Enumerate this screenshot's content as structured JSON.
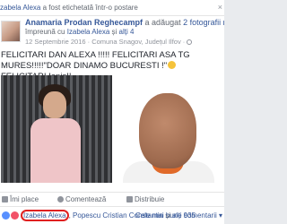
{
  "tagline": {
    "name": "zabela Alexa",
    "text": " a fost etichetată într-o postare",
    "close": "×"
  },
  "post": {
    "author": "Anamaria Prodan Reghecampf",
    "added_prefix": " a adăugat ",
    "added_link": "2 fotografii noi",
    "added_suffix": " —",
    "with_prefix": "împreună cu ",
    "with_name": "Izabela Alexa",
    "with_and": " și ",
    "with_others": "alți 4",
    "date": "12 Septembrie 2016 · Comuna Snagov, Județul Ilfov · ",
    "text_part1": "FELICITARI DAN ALEXA !!!!! FELICITARI ASA TG MURES!!!!!\"DOAR DINAMO BUCURESTI !\"",
    "text_part2": " FELICITARI Ianis!!"
  },
  "actions": {
    "like": "Îmi place",
    "comment": "Comentează",
    "share": "Distribuie"
  },
  "reactions": {
    "first": "Izabela Alexa",
    "sep1": ", ",
    "second": "Popescu Cristian Constantin",
    "and": " și ",
    "others": "alți 935",
    "relevant": "Cele mai bune comentarii ▾"
  },
  "colors": {
    "link": "#365899",
    "like_icon": "#5890ff",
    "love_icon": "#f25268",
    "highlight_circle": "#e02020"
  }
}
